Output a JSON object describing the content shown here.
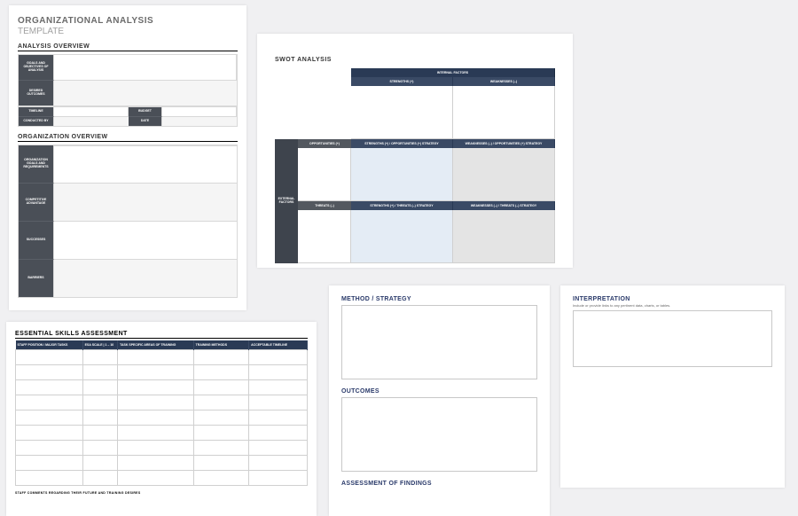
{
  "panel1": {
    "title": "ORGANIZATIONAL ANALYSIS",
    "subtitle": "TEMPLATE",
    "section_analysis_overview": "ANALYSIS OVERVIEW",
    "ao_labels": {
      "goals": "GOALS AND OBJECTIVES OF ANALYSIS",
      "desired": "DESIRED OUTCOMES",
      "timeline": "TIMELINE",
      "budget": "BUDGET",
      "conducted_by": "CONDUCTED BY",
      "date": "DATE"
    },
    "section_org_overview": "ORGANIZATION OVERVIEW",
    "oo_labels": {
      "org_goals": "ORGANIZATION GOALS AND REQUIREMENTS",
      "competitive": "COMPETITIVE ADVANTAGE",
      "successes": "SUCCESSES",
      "barriers": "BARRIERS"
    }
  },
  "panel2": {
    "title": "SWOT ANALYSIS",
    "internal_factors": "INTERNAL FACTORS",
    "external_factors": "EXTERNAL FACTORS",
    "strengths": "STRENGTHS (+)",
    "weaknesses": "WEAKNESSES (–)",
    "opportunities": "OPPORTUNITIES (+)",
    "threats": "THREATS (–)",
    "so": "STRENGTHS (+) / OPPORTUNITIES (+) STRATEGY",
    "wo": "WEAKNESSES (–) / OPPORTUNITIES (+) STRATEGY",
    "st": "STRENGTHS (+) / THREATS (–) STRATEGY",
    "wt": "WEAKNESSES (–) / THREATS (–) STRATEGY"
  },
  "panel3": {
    "title": "ESSENTIAL SKILLS ASSESSMENT",
    "cols": {
      "c1": "STAFF POSITION / MAJOR TASKS",
      "c2": "ESA SCALE | 1 – 10",
      "c3": "TASK SPECIFIC AREAS OF TRAINING",
      "c4": "TRAINING METHODS",
      "c5": "ACCEPTABLE TIMELINE"
    },
    "footnote": "STAFF COMMENTS REGARDING THEIR FUTURE AND TRAINING DESIRES"
  },
  "panel4": {
    "method": "METHOD / STRATEGY",
    "outcomes": "OUTCOMES",
    "assessment": "ASSESSMENT OF FINDINGS"
  },
  "panel5": {
    "title": "INTERPRETATION",
    "note": "Include or provide links to any pertinent data, charts, or tables."
  }
}
